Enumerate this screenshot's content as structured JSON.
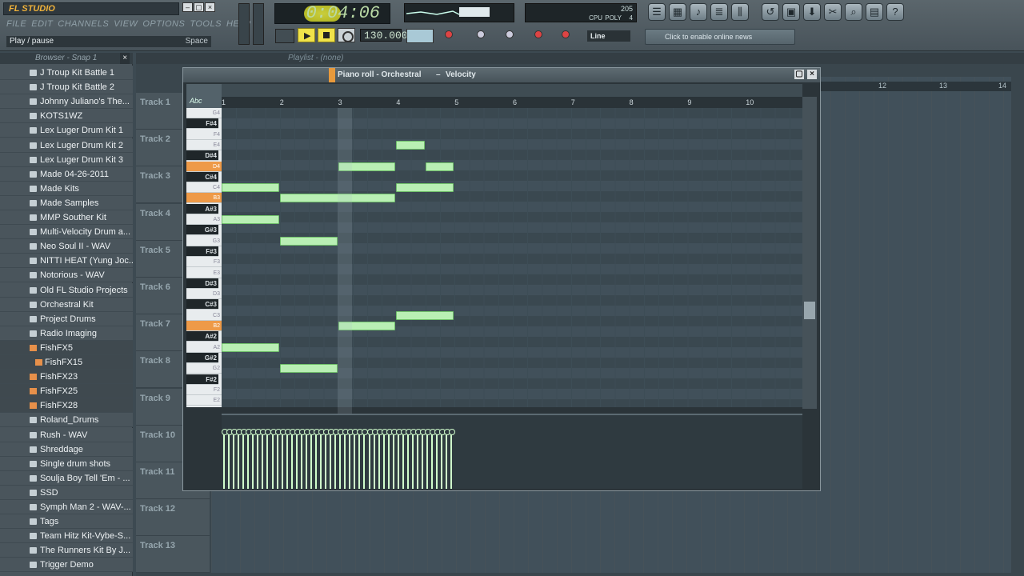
{
  "app": {
    "logo": "FL STUDIO",
    "hint_text": "Play / pause",
    "hint_key": "Space"
  },
  "menu": [
    "FILE",
    "EDIT",
    "CHANNELS",
    "VIEW",
    "OPTIONS",
    "TOOLS",
    "HELP"
  ],
  "transport": {
    "time": "0:04:06",
    "tempo": "130.000",
    "line_mode": "Line"
  },
  "cpu": {
    "value": "205",
    "label1": "CPU",
    "label2": "POLY",
    "poly": "4"
  },
  "news": {
    "text": "Click to enable online news"
  },
  "browser": {
    "title": "Browser - Snap 1",
    "items": [
      {
        "label": "J Troup Kit Battle 1",
        "type": "folder"
      },
      {
        "label": "J Troup Kit Battle 2",
        "type": "folder"
      },
      {
        "label": "Johnny Juliano's The...",
        "type": "folder"
      },
      {
        "label": "KOTS1WZ",
        "type": "folder"
      },
      {
        "label": "Lex Luger Drum Kit 1",
        "type": "folder"
      },
      {
        "label": "Lex Luger Drum Kit 2",
        "type": "folder"
      },
      {
        "label": "Lex Luger Drum Kit 3",
        "type": "folder"
      },
      {
        "label": "Made 04-26-2011",
        "type": "folder"
      },
      {
        "label": "Made Kits",
        "type": "folder"
      },
      {
        "label": "Made Samples",
        "type": "folder"
      },
      {
        "label": "MMP Souther Kit",
        "type": "folder"
      },
      {
        "label": "Multi-Velocity Drum a...",
        "type": "folder"
      },
      {
        "label": "Neo Soul II - WAV",
        "type": "folder"
      },
      {
        "label": "NITTI HEAT (Yung Joc...",
        "type": "folder"
      },
      {
        "label": "Notorious - WAV",
        "type": "folder"
      },
      {
        "label": "Old FL Studio Projects",
        "type": "folder"
      },
      {
        "label": "Orchestral Kit",
        "type": "folder"
      },
      {
        "label": "Project Drums",
        "type": "folder"
      },
      {
        "label": "Radio Imaging",
        "type": "folder"
      },
      {
        "label": "FishFX5",
        "type": "file"
      },
      {
        "label": "FishFX15",
        "type": "file",
        "selected": true
      },
      {
        "label": "FishFX23",
        "type": "file"
      },
      {
        "label": "FishFX25",
        "type": "file"
      },
      {
        "label": "FishFX28",
        "type": "file"
      },
      {
        "label": "Roland_Drums",
        "type": "folder"
      },
      {
        "label": "Rush - WAV",
        "type": "folder"
      },
      {
        "label": "Shreddage",
        "type": "folder"
      },
      {
        "label": "Single drum shots",
        "type": "folder"
      },
      {
        "label": "Soulja Boy Tell 'Em - ...",
        "type": "folder"
      },
      {
        "label": "SSD",
        "type": "folder"
      },
      {
        "label": "Symph Man 2 - WAV-...",
        "type": "folder"
      },
      {
        "label": "Tags",
        "type": "folder"
      },
      {
        "label": "Team Hitz Kit-Vybe-S...",
        "type": "folder"
      },
      {
        "label": "The Runners Kit By J...",
        "type": "folder"
      },
      {
        "label": "Trigger Demo",
        "type": "folder"
      }
    ]
  },
  "playlist": {
    "title": "Playlist - (none)",
    "tracks": [
      "Track 1",
      "Track 2",
      "Track 3",
      "Track 4",
      "Track 5",
      "Track 6",
      "Track 7",
      "Track 8",
      "Track 9",
      "Track 10",
      "Track 11",
      "Track 12",
      "Track 13"
    ],
    "ruler": [
      "12",
      "13",
      "14"
    ]
  },
  "piano_roll": {
    "title": "Piano roll - Orchestral",
    "mode": "Velocity",
    "ruler": [
      "1",
      "2",
      "3",
      "4",
      "5",
      "6",
      "7",
      "8",
      "9",
      "10"
    ],
    "keys": [
      {
        "label": "G4",
        "black": false
      },
      {
        "label": "F#4",
        "black": true
      },
      {
        "label": "F4",
        "black": false
      },
      {
        "label": "E4",
        "black": false
      },
      {
        "label": "D#4",
        "black": true
      },
      {
        "label": "D4",
        "black": false,
        "hi": true
      },
      {
        "label": "C#4",
        "black": true
      },
      {
        "label": "C4",
        "black": false
      },
      {
        "label": "B3",
        "black": false,
        "hi": true
      },
      {
        "label": "A#3",
        "black": true
      },
      {
        "label": "A3",
        "black": false
      },
      {
        "label": "G#3",
        "black": true
      },
      {
        "label": "G3",
        "black": false
      },
      {
        "label": "F#3",
        "black": true
      },
      {
        "label": "F3",
        "black": false
      },
      {
        "label": "E3",
        "black": false
      },
      {
        "label": "D#3",
        "black": true
      },
      {
        "label": "D3",
        "black": false
      },
      {
        "label": "C#3",
        "black": true
      },
      {
        "label": "C3",
        "black": false
      },
      {
        "label": "B2",
        "black": false,
        "hi": true
      },
      {
        "label": "A#2",
        "black": true
      },
      {
        "label": "A2",
        "black": false
      },
      {
        "label": "G#2",
        "black": true
      },
      {
        "label": "G2",
        "black": false
      },
      {
        "label": "F#2",
        "black": true
      },
      {
        "label": "F2",
        "black": false
      },
      {
        "label": "E2",
        "black": false
      }
    ],
    "notes": [
      {
        "pitch": "C4",
        "start": 0,
        "len": 1
      },
      {
        "pitch": "A3",
        "start": 0,
        "len": 1
      },
      {
        "pitch": "B3",
        "start": 1,
        "len": 2
      },
      {
        "pitch": "G3",
        "start": 1,
        "len": 1
      },
      {
        "pitch": "D4",
        "start": 2,
        "len": 1
      },
      {
        "pitch": "E4",
        "start": 3,
        "len": 0.5
      },
      {
        "pitch": "D4",
        "start": 3.5,
        "len": 0.5
      },
      {
        "pitch": "C4",
        "start": 3,
        "len": 1
      },
      {
        "pitch": "C3",
        "start": 3,
        "len": 1
      },
      {
        "pitch": "B2",
        "start": 2,
        "len": 1
      },
      {
        "pitch": "A2",
        "start": 0,
        "len": 1
      },
      {
        "pitch": "G2",
        "start": 1,
        "len": 1
      }
    ]
  }
}
